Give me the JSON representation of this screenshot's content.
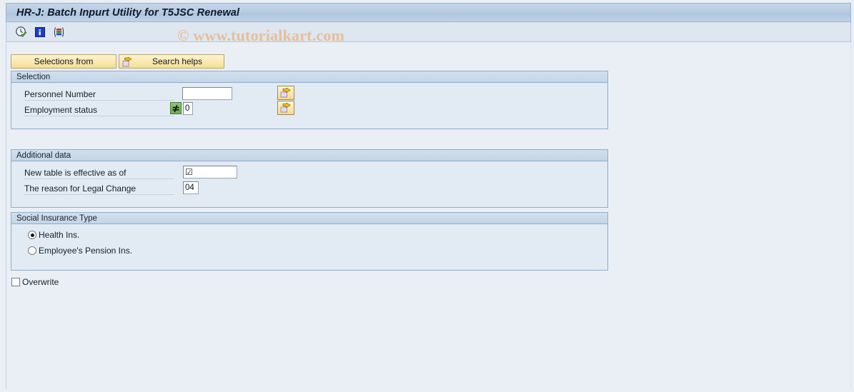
{
  "window": {
    "title": "HR-J: Batch Inpurt Utility for T5JSC Renewal"
  },
  "watermark": {
    "text": "© www.tutorialkart.com"
  },
  "toolbar": {
    "items": [
      {
        "name": "execute-icon",
        "title": "Execute"
      },
      {
        "name": "info-icon",
        "title": "Information"
      },
      {
        "name": "variant-icon",
        "title": "Get Variant"
      }
    ]
  },
  "tabs": [
    {
      "label": "Selections from",
      "icon": ""
    },
    {
      "label": "Search helps",
      "icon": "arrow-right-icon"
    }
  ],
  "selection_group": {
    "title": "Selection",
    "fields": [
      {
        "label": "Personnel Number",
        "value": "",
        "has_operator": false,
        "arrow_button": "multiple-selection-icon"
      },
      {
        "label": "Employment status",
        "value": "0",
        "has_operator": true,
        "operator_glyph": "≠",
        "arrow_button": "multiple-selection-icon"
      }
    ]
  },
  "additional_data_group": {
    "title": "Additional data",
    "fields": [
      {
        "label": "New table is effective as of",
        "value": "☑"
      },
      {
        "label": "The reason for Legal Change",
        "value": "04"
      }
    ]
  },
  "social_insurance_group": {
    "title": "Social Insurance Type",
    "options": [
      {
        "label": "Health Ins.",
        "selected": true
      },
      {
        "label": "Employee's Pension Ins.",
        "selected": false
      }
    ]
  },
  "overwrite": {
    "label": "Overwrite",
    "checked": false
  },
  "colors": {
    "background": "#eaeff6",
    "titlebar": "#bed1e5",
    "groupbox_border": "#8fadc9",
    "groupbox_body": "#e2eaf3",
    "button_yellow": "#f9e8ae",
    "watermark": "#e8b98a",
    "operator_green": "#6fae58"
  }
}
